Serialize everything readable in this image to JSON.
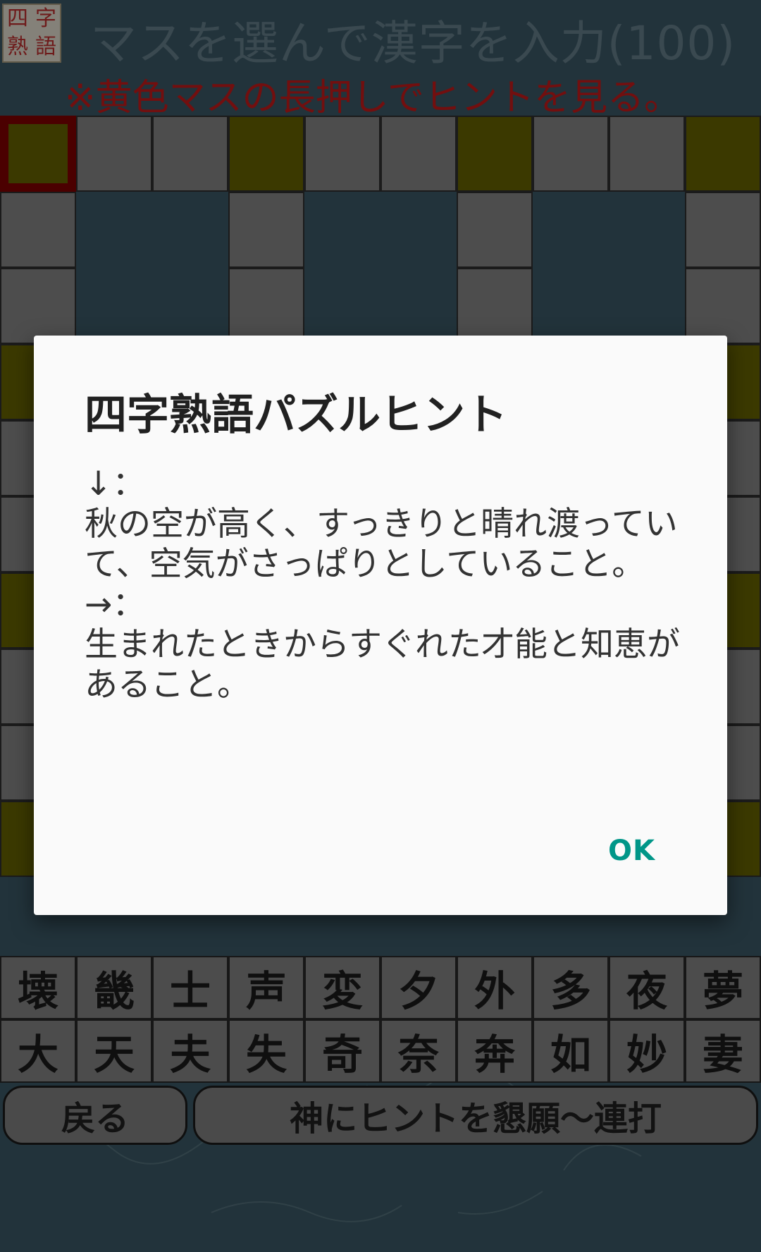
{
  "header": {
    "logo_chars": [
      "四",
      "字",
      "熟",
      "語"
    ],
    "title": "マスを選んで漢字を入力(100)",
    "subtitle": "※黄色マスの長押しでヒントを見る。"
  },
  "keyboard": {
    "row1": [
      "壊",
      "畿",
      "士",
      "声",
      "変",
      "夕",
      "外",
      "多",
      "夜",
      "夢"
    ],
    "row2": [
      "大",
      "天",
      "夫",
      "失",
      "奇",
      "奈",
      "奔",
      "如",
      "妙",
      "妻"
    ]
  },
  "buttons": {
    "back": "戻る",
    "hint": "神にヒントを懇願～連打"
  },
  "dialog": {
    "title": "四字熟語パズルヒント",
    "body": "↓：\n秋の空が高く、すっきりと晴れ渡っていて、空気がさっぱりとしていること。\n→：\n生まれたときからすぐれた才能と知恵があること。",
    "ok": "OK"
  },
  "colors": {
    "background": "#3f5f6d",
    "cell_white": "#8f8f8f",
    "cell_yellow": "#6d6a00",
    "selected_border": "#8b0000",
    "accent": "#009688",
    "subtitle_red": "#d21c1c"
  }
}
